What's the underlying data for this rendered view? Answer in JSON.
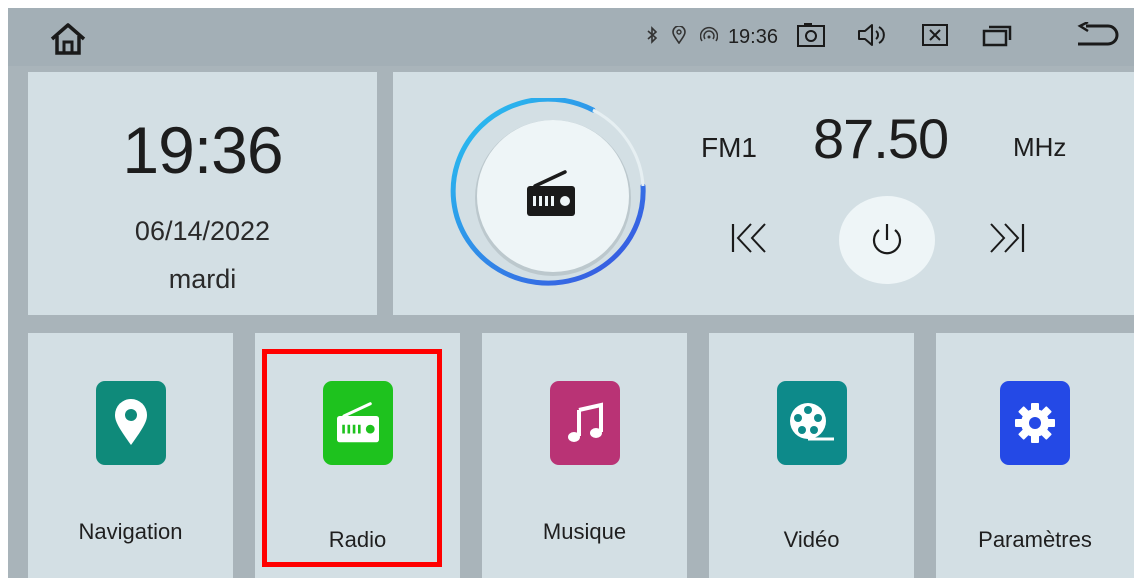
{
  "statusbar": {
    "time": "19:36",
    "icons": [
      "home-icon",
      "bluetooth-icon",
      "location-icon",
      "hotspot-icon",
      "screenshot-icon",
      "volume-icon",
      "close-app-icon",
      "recent-apps-icon",
      "back-icon"
    ]
  },
  "clock": {
    "time": "19:36",
    "date": "06/14/2022",
    "day": "mardi"
  },
  "radio": {
    "band": "FM1",
    "frequency": "87.50",
    "unit": "MHz",
    "icons": [
      "radio-icon",
      "skip-previous-icon",
      "power-icon",
      "skip-next-icon"
    ]
  },
  "apps": [
    {
      "label": "Navigation",
      "icon": "map-pin-icon",
      "color": "#0f8a7a"
    },
    {
      "label": "Radio",
      "icon": "radio-icon",
      "color": "#1ec21e"
    },
    {
      "label": "Musique",
      "icon": "music-note-icon",
      "color": "#b93375"
    },
    {
      "label": "Vidéo",
      "icon": "film-reel-icon",
      "color": "#0d8a8a"
    },
    {
      "label": "Paramètres",
      "icon": "gear-icon",
      "color": "#2449e6"
    }
  ],
  "highlight": {
    "target": "Radio",
    "color": "#ff0000"
  }
}
